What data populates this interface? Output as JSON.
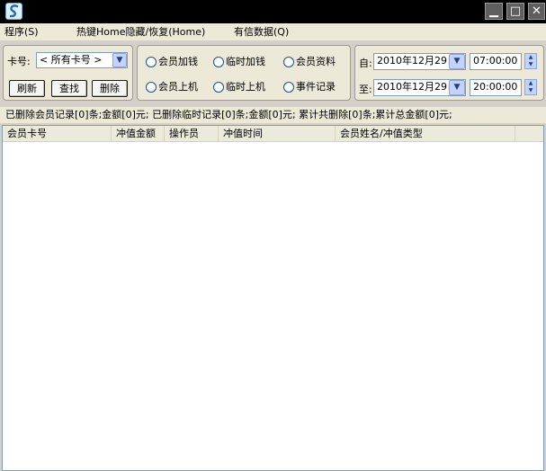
{
  "window_buttons": {
    "minimize": "▁",
    "maximize": "□",
    "close": "✕"
  },
  "menu": [
    {
      "label": "程序(S)"
    },
    {
      "label": "热键Home隐藏/恢复(Home)"
    },
    {
      "label": "有信数据(Q)"
    }
  ],
  "filter": {
    "card_label": "卡号:",
    "card_value": "< 所有卡号 >",
    "buttons": [
      "刷新",
      "查找",
      "删除"
    ]
  },
  "radios": [
    {
      "label": "会员加钱"
    },
    {
      "label": "临时加钱"
    },
    {
      "label": "会员资料"
    },
    {
      "label": "会员上机"
    },
    {
      "label": "临时上机"
    },
    {
      "label": "事件记录"
    }
  ],
  "date_range": {
    "from_label": "自:",
    "to_label": "至:",
    "from_date": "2010年12月29日",
    "to_date": "2010年12月29日",
    "from_time": "07:00:00",
    "to_time": "20:00:00"
  },
  "status_text": "已删除会员记录[0]条;金额[0]元; 已删除临时记录[0]条;金额[0]元; 累计共删除[0]条;累计总金额[0]元;",
  "list": {
    "columns": [
      "会员卡号",
      "冲值金额",
      "操作员",
      "冲值时间",
      "会员姓名/冲值类型"
    ],
    "rows": []
  }
}
